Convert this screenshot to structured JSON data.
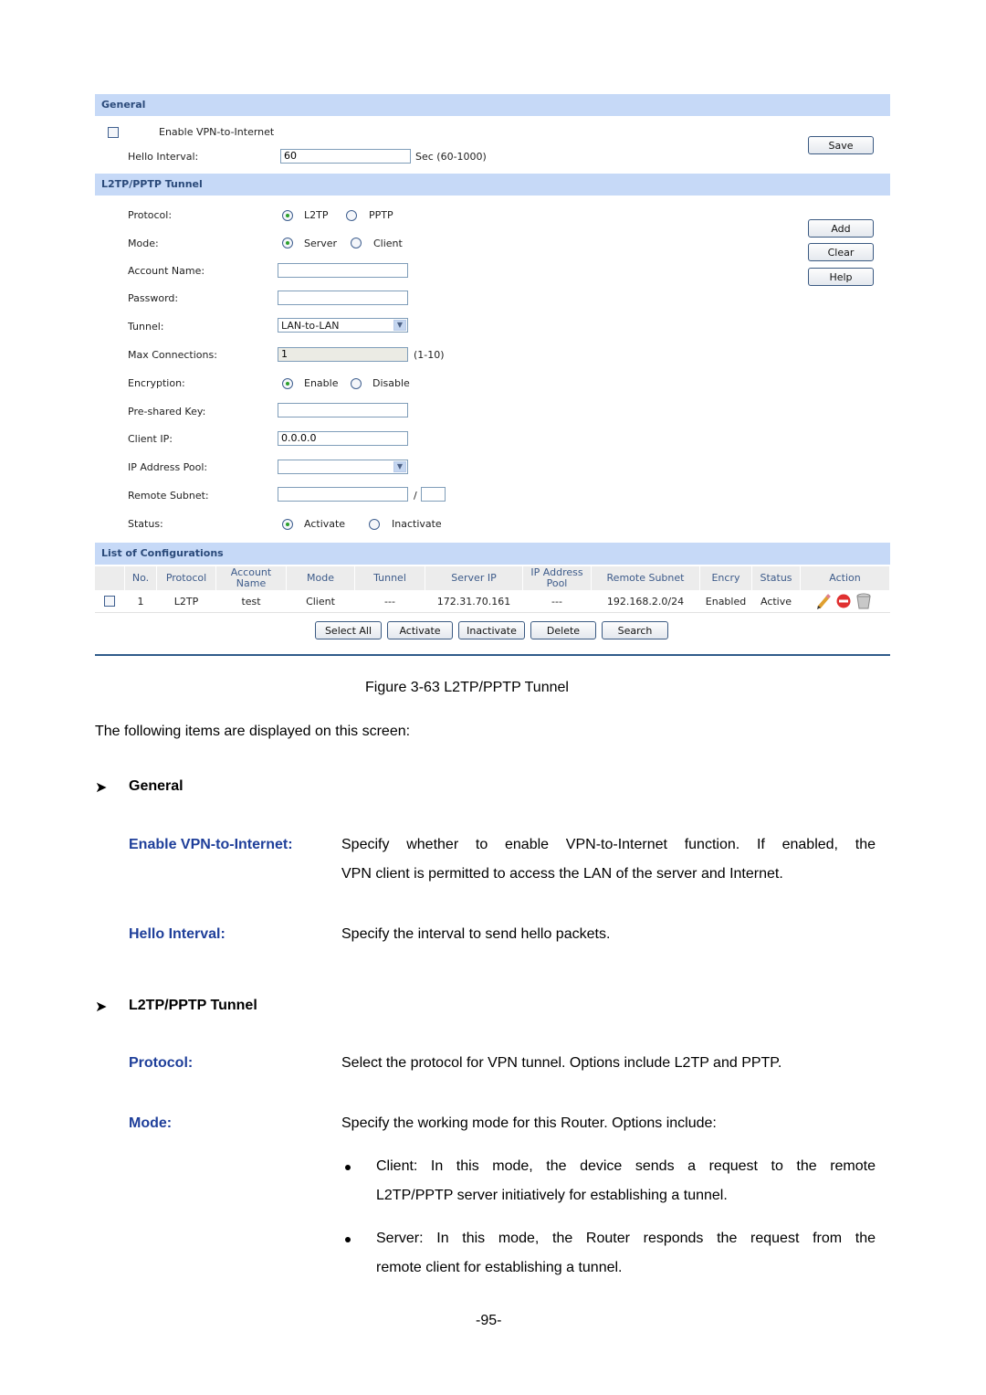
{
  "ui": {
    "general": {
      "header": "General",
      "enable_vpn_label": "Enable VPN-to-Internet",
      "enable_vpn_checked": false,
      "hello_interval_label": "Hello Interval:",
      "hello_interval_value": "60",
      "hello_interval_hint": "Sec (60-1000)",
      "save_button": "Save"
    },
    "tunnel": {
      "header": "L2TP/PPTP Tunnel",
      "protocol_label": "Protocol:",
      "protocol_options": [
        "L2TP",
        "PPTP"
      ],
      "protocol_selected": "L2TP",
      "mode_label": "Mode:",
      "mode_options": [
        "Server",
        "Client"
      ],
      "mode_selected": "Server",
      "account_name_label": "Account Name:",
      "account_name_value": "",
      "password_label": "Password:",
      "password_value": "",
      "tunnel_label": "Tunnel:",
      "tunnel_value": "LAN-to-LAN",
      "max_conn_label": "Max Connections:",
      "max_conn_value": "1",
      "max_conn_hint": "(1-10)",
      "encryption_label": "Encryption:",
      "encryption_options": [
        "Enable",
        "Disable"
      ],
      "encryption_selected": "Enable",
      "psk_label": "Pre-shared Key:",
      "psk_value": "",
      "client_ip_label": "Client IP:",
      "client_ip_value": "0.0.0.0",
      "ip_pool_label": "IP Address Pool:",
      "ip_pool_value": "",
      "remote_subnet_label": "Remote Subnet:",
      "remote_subnet_value": "",
      "remote_subnet_sep": "/",
      "remote_subnet_mask": "",
      "status_label": "Status:",
      "status_options": [
        "Activate",
        "Inactivate"
      ],
      "status_selected": "Activate",
      "add_button": "Add",
      "clear_button": "Clear",
      "help_button": "Help"
    },
    "list": {
      "header": "List of Configurations",
      "columns": [
        "",
        "No.",
        "Protocol",
        "Account Name",
        "Mode",
        "Tunnel",
        "Server IP",
        "IP Address Pool",
        "Remote Subnet",
        "Encry",
        "Status",
        "Action"
      ],
      "rows": [
        {
          "no": "1",
          "protocol": "L2TP",
          "account": "test",
          "mode": "Client",
          "tunnel": "---",
          "server_ip": "172.31.70.161",
          "pool": "---",
          "remote_subnet": "192.168.2.0/24",
          "encry": "Enabled",
          "status": "Active",
          "actions": [
            "edit-icon",
            "disable-icon",
            "delete-icon"
          ]
        }
      ],
      "buttons": [
        "Select All",
        "Activate",
        "Inactivate",
        "Delete",
        "Search"
      ]
    }
  },
  "doc": {
    "figure_caption": "Figure 3-63 L2TP/PPTP Tunnel",
    "intro": "The following items are displayed on this screen:",
    "sections": [
      {
        "title": "General",
        "items": [
          {
            "term": "Enable VPN-to-Internet:",
            "desc_lines": [
              "Specify whether to enable VPN-to-Internet function. If enabled, the",
              "VPN client is permitted to access the LAN of the server and Internet."
            ]
          },
          {
            "term": "Hello Interval:",
            "desc_lines": [
              "Specify the interval to send hello packets."
            ]
          }
        ]
      },
      {
        "title": "L2TP/PPTP Tunnel",
        "items": [
          {
            "term": "Protocol:",
            "desc_lines": [
              "Select the protocol for VPN tunnel. Options include L2TP and PPTP."
            ]
          },
          {
            "term": "Mode:",
            "desc_lines": [
              "Specify the working mode for this Router. Options include:"
            ],
            "bullets": [
              [
                "Client: In this mode, the device sends a request to the remote",
                "L2TP/PPTP server initiatively for establishing a tunnel."
              ],
              [
                "Server: In this mode, the Router responds the request from the",
                "remote client for establishing a tunnel."
              ]
            ]
          }
        ]
      }
    ],
    "page_number": "-95-"
  },
  "colors": {
    "section_header_bg": "#c6d9f7",
    "section_header_text": "#2b4a7a",
    "term_blue": "#1f3f9a",
    "rule_blue": "#2f5b8a"
  }
}
